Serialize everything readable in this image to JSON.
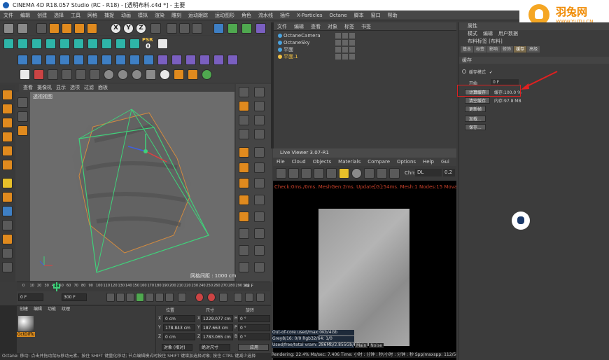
{
  "titlebar": {
    "title": "CINEMA 4D R18.057 Studio (RC - R18) - [透明布料.c4d *] - 主要"
  },
  "menu": [
    "文件",
    "编辑",
    "创建",
    "选择",
    "工具",
    "网格",
    "捕捉",
    "动画",
    "模拟",
    "渲染",
    "雕刻",
    "运动跟踪",
    "运动图形",
    "角色",
    "流水线",
    "插件",
    "X-Particles",
    "Octane",
    "脚本",
    "窗口",
    "帮助"
  ],
  "logo": {
    "name": "羽兔网",
    "url": "WWW.YUTU.CN"
  },
  "toolbar": {
    "xyz": [
      "X",
      "Y",
      "Z"
    ],
    "psr_label": "PSR",
    "psr_value": "0"
  },
  "viewport": {
    "menu": [
      "查看",
      "摄像机",
      "显示",
      "选项",
      "过滤",
      "面板"
    ],
    "label": "透视视图",
    "footer": "网格间距 : 1000 cm"
  },
  "object_manager": {
    "menu": [
      "文件",
      "编辑",
      "查看",
      "对象",
      "标签",
      "书签"
    ],
    "objects": [
      {
        "name": "OctaneCamera",
        "color": "#4aa3df"
      },
      {
        "name": "OctaneSky",
        "color": "#4aa3df"
      },
      {
        "name": "平面",
        "color": "#4aa3df"
      },
      {
        "name": "平面.1",
        "color": "#f2c144"
      }
    ]
  },
  "attributes": {
    "header": "属性",
    "menu": [
      "模式",
      "编辑",
      "用户数据"
    ],
    "object_name": "布料标签 [布料]",
    "tabs": [
      "基本",
      "标签",
      "影响",
      "修饰",
      "缓存",
      "高级"
    ],
    "active_tab": "缓存",
    "section": "缓存",
    "cache_mode_label": "缓存模式",
    "start_label": "开始",
    "start_value": "0 F",
    "calc_cache": "计算缓存",
    "cache_pct": "缓存:100.0 %",
    "clear_cache": "清空缓存",
    "memory": "内存:97.8 MB",
    "update_frame": "更新帧",
    "load": "加载...",
    "save": "保存..."
  },
  "live_viewer": {
    "title": "Live Viewer 3.07-R1",
    "menu": [
      "File",
      "Cloud",
      "Objects",
      "Materials",
      "Compare",
      "Options",
      "Help",
      "Gui"
    ],
    "chn_label": "Chn:",
    "chn_value": "DL",
    "zoom": "0.2",
    "status": "Check:0ms./0ms. MeshGen:2ms. Update[G]:54ms. Mesh:1 Nodes:15 Movable:2  0:0",
    "info": [
      "Out-of-core used/max:0Kb/4Gb",
      "Grey8/16: 0/0     Rgb32/64: 1/0",
      "Used/free/total vram: 286Mb/2.855Gb/4Gb"
    ],
    "tabs": [
      "Main",
      "Noise"
    ],
    "bottom": "Rendering: 22.4%   Ms/sec: 7.406   Time: 小时 : 分钟 : 秒/小时 : 分钟 : 秒   Spp/maxspp: 112/500   Tri"
  },
  "timeline": {
    "ticks": [
      "0",
      "10",
      "20",
      "30",
      "40",
      "50",
      "60",
      "70",
      "80",
      "90",
      "100",
      "110",
      "120",
      "130",
      "140",
      "150",
      "160",
      "170",
      "180",
      "190",
      "200",
      "210",
      "220",
      "230",
      "240",
      "250",
      "260",
      "270",
      "280",
      "290",
      "300"
    ],
    "current": "48",
    "end_label": "48 F"
  },
  "transport": {
    "start": "0 F",
    "end": "300 F"
  },
  "materials": {
    "menu": [
      "创建",
      "编辑",
      "功能",
      "纹理"
    ],
    "swatch": "OctDiffu"
  },
  "coords": {
    "headers": [
      "位置",
      "尺寸",
      "旋转"
    ],
    "rows": [
      {
        "axis": "X",
        "pos": "0 cm",
        "size": "1229.077 cm",
        "rot_label": "H",
        "rot": "0 °"
      },
      {
        "axis": "Y",
        "pos": "178.843 cm",
        "size": "187.663 cm",
        "rot_label": "P",
        "rot": "0 °"
      },
      {
        "axis": "Z",
        "pos": "0 cm",
        "size": "1783.065 cm",
        "rot_label": "B",
        "rot": "0 °"
      }
    ],
    "mode1": "对象 (相对)",
    "mode2": "绝对尺寸",
    "apply": "应用"
  },
  "statusbar": "Octane:    移动: 点击并拖动鼠标移动元素。按住 SHIFT 键量化移动; 节点编辑模式时按住 SHIFT 键增加选择对象; 按住 CTRL 键减少选择"
}
